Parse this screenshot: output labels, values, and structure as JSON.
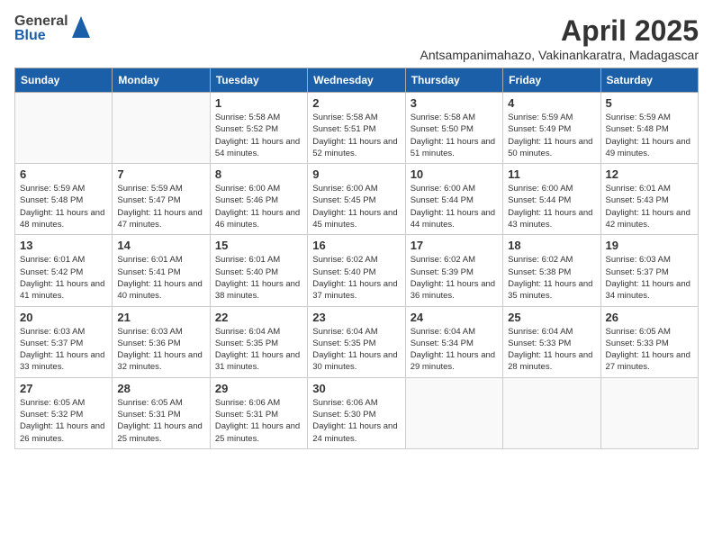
{
  "header": {
    "logo": {
      "general": "General",
      "blue": "Blue"
    },
    "title": "April 2025",
    "subtitle": "Antsampanimahazo, Vakinankaratra, Madagascar"
  },
  "calendar": {
    "days_of_week": [
      "Sunday",
      "Monday",
      "Tuesday",
      "Wednesday",
      "Thursday",
      "Friday",
      "Saturday"
    ],
    "weeks": [
      [
        {
          "day": "",
          "info": ""
        },
        {
          "day": "",
          "info": ""
        },
        {
          "day": "1",
          "info": "Sunrise: 5:58 AM\nSunset: 5:52 PM\nDaylight: 11 hours and 54 minutes."
        },
        {
          "day": "2",
          "info": "Sunrise: 5:58 AM\nSunset: 5:51 PM\nDaylight: 11 hours and 52 minutes."
        },
        {
          "day": "3",
          "info": "Sunrise: 5:58 AM\nSunset: 5:50 PM\nDaylight: 11 hours and 51 minutes."
        },
        {
          "day": "4",
          "info": "Sunrise: 5:59 AM\nSunset: 5:49 PM\nDaylight: 11 hours and 50 minutes."
        },
        {
          "day": "5",
          "info": "Sunrise: 5:59 AM\nSunset: 5:48 PM\nDaylight: 11 hours and 49 minutes."
        }
      ],
      [
        {
          "day": "6",
          "info": "Sunrise: 5:59 AM\nSunset: 5:48 PM\nDaylight: 11 hours and 48 minutes."
        },
        {
          "day": "7",
          "info": "Sunrise: 5:59 AM\nSunset: 5:47 PM\nDaylight: 11 hours and 47 minutes."
        },
        {
          "day": "8",
          "info": "Sunrise: 6:00 AM\nSunset: 5:46 PM\nDaylight: 11 hours and 46 minutes."
        },
        {
          "day": "9",
          "info": "Sunrise: 6:00 AM\nSunset: 5:45 PM\nDaylight: 11 hours and 45 minutes."
        },
        {
          "day": "10",
          "info": "Sunrise: 6:00 AM\nSunset: 5:44 PM\nDaylight: 11 hours and 44 minutes."
        },
        {
          "day": "11",
          "info": "Sunrise: 6:00 AM\nSunset: 5:44 PM\nDaylight: 11 hours and 43 minutes."
        },
        {
          "day": "12",
          "info": "Sunrise: 6:01 AM\nSunset: 5:43 PM\nDaylight: 11 hours and 42 minutes."
        }
      ],
      [
        {
          "day": "13",
          "info": "Sunrise: 6:01 AM\nSunset: 5:42 PM\nDaylight: 11 hours and 41 minutes."
        },
        {
          "day": "14",
          "info": "Sunrise: 6:01 AM\nSunset: 5:41 PM\nDaylight: 11 hours and 40 minutes."
        },
        {
          "day": "15",
          "info": "Sunrise: 6:01 AM\nSunset: 5:40 PM\nDaylight: 11 hours and 38 minutes."
        },
        {
          "day": "16",
          "info": "Sunrise: 6:02 AM\nSunset: 5:40 PM\nDaylight: 11 hours and 37 minutes."
        },
        {
          "day": "17",
          "info": "Sunrise: 6:02 AM\nSunset: 5:39 PM\nDaylight: 11 hours and 36 minutes."
        },
        {
          "day": "18",
          "info": "Sunrise: 6:02 AM\nSunset: 5:38 PM\nDaylight: 11 hours and 35 minutes."
        },
        {
          "day": "19",
          "info": "Sunrise: 6:03 AM\nSunset: 5:37 PM\nDaylight: 11 hours and 34 minutes."
        }
      ],
      [
        {
          "day": "20",
          "info": "Sunrise: 6:03 AM\nSunset: 5:37 PM\nDaylight: 11 hours and 33 minutes."
        },
        {
          "day": "21",
          "info": "Sunrise: 6:03 AM\nSunset: 5:36 PM\nDaylight: 11 hours and 32 minutes."
        },
        {
          "day": "22",
          "info": "Sunrise: 6:04 AM\nSunset: 5:35 PM\nDaylight: 11 hours and 31 minutes."
        },
        {
          "day": "23",
          "info": "Sunrise: 6:04 AM\nSunset: 5:35 PM\nDaylight: 11 hours and 30 minutes."
        },
        {
          "day": "24",
          "info": "Sunrise: 6:04 AM\nSunset: 5:34 PM\nDaylight: 11 hours and 29 minutes."
        },
        {
          "day": "25",
          "info": "Sunrise: 6:04 AM\nSunset: 5:33 PM\nDaylight: 11 hours and 28 minutes."
        },
        {
          "day": "26",
          "info": "Sunrise: 6:05 AM\nSunset: 5:33 PM\nDaylight: 11 hours and 27 minutes."
        }
      ],
      [
        {
          "day": "27",
          "info": "Sunrise: 6:05 AM\nSunset: 5:32 PM\nDaylight: 11 hours and 26 minutes."
        },
        {
          "day": "28",
          "info": "Sunrise: 6:05 AM\nSunset: 5:31 PM\nDaylight: 11 hours and 25 minutes."
        },
        {
          "day": "29",
          "info": "Sunrise: 6:06 AM\nSunset: 5:31 PM\nDaylight: 11 hours and 25 minutes."
        },
        {
          "day": "30",
          "info": "Sunrise: 6:06 AM\nSunset: 5:30 PM\nDaylight: 11 hours and 24 minutes."
        },
        {
          "day": "",
          "info": ""
        },
        {
          "day": "",
          "info": ""
        },
        {
          "day": "",
          "info": ""
        }
      ]
    ]
  }
}
